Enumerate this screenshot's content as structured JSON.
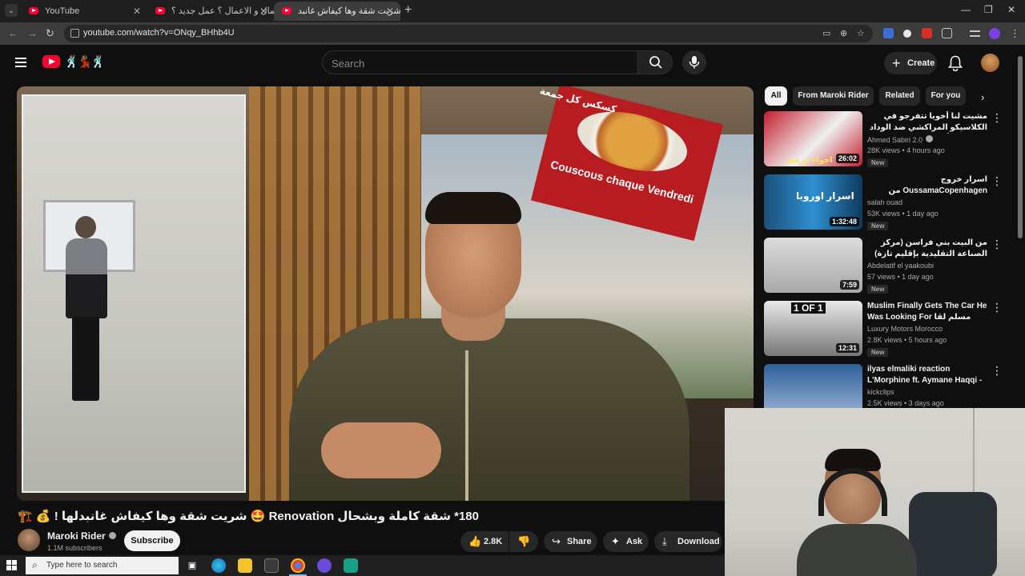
{
  "browser": {
    "tabs": [
      {
        "title": "YouTube",
        "active": false
      },
      {
        "title": "رحلة المال و الاعمال ؟ عمل جديد ؟",
        "active": false
      },
      {
        "title": "شريت شقة وها كيفاش غانبد..",
        "active": true
      }
    ],
    "url": "youtube.com/watch?v=ONqy_BHhb4U"
  },
  "header": {
    "search_placeholder": "Search",
    "create_label": "Create",
    "doodle": "🕺🏽💃🏽🕺🏽"
  },
  "video": {
    "sign_arabic": "كسكس كل جمعة",
    "sign_text": "Couscous chaque Vendredi",
    "title": "180* شقة كاملة وبشحال Renovation 🤩 شريت شقة وها كيفاش غانبدلها ! 💰 🏗️"
  },
  "channel": {
    "name": "Maroki Rider",
    "subscribers": "1.1M subscribers",
    "subscribe_label": "Subscribe"
  },
  "actions": {
    "likes": "2.8K",
    "share": "Share",
    "ask": "Ask",
    "download": "Download"
  },
  "chips": [
    "All",
    "From Maroki Rider",
    "Related",
    "For you"
  ],
  "recommendations": [
    {
      "title": "مشيت لنا أخويا تتفرجو في الكلاسيكو المراكشي ضد الوداد البيضاوي أجواء ... 😍",
      "channel": "Ahmed Sabiri 2.0",
      "verified": true,
      "stats": "28K views • 4 hours ago",
      "badge": "New",
      "duration": "26:02"
    },
    {
      "title": "اسرار خروج OussamaCopenhagen من الفقر...",
      "channel": "salah ouad",
      "verified": false,
      "stats": "53K views • 1 day ago",
      "badge": "New",
      "duration": "1:32:48"
    },
    {
      "title": "من البيت بني فراسن (مركز الصناعة التقليدية بإقليم تازة) المغرب وتكتشف سوقها...",
      "channel": "Abdelatif el yaakoubi",
      "verified": false,
      "stats": "57 views • 1 day ago",
      "badge": "New",
      "duration": "7:59"
    },
    {
      "title": "Muslim Finally Gets The Car He Was Looking For مسلم لقا الطوموبيل...",
      "channel": "Luxury Motors Morocco",
      "verified": false,
      "stats": "2.8K views • 5 hours ago",
      "badge": "New",
      "duration": "12:31"
    },
    {
      "title": "ilyas elmaliki reaction L'Morphine ft. Aymane Haqqi - ...",
      "channel": "kickclips",
      "verified": false,
      "stats": "2.5K views • 3 days ago",
      "badge": "",
      "duration": ""
    }
  ],
  "thumb_text": [
    "اجواء مرعبة",
    "اسرار اوروبا",
    "1 OF 1"
  ],
  "taskbar": {
    "search_placeholder": "Type here to search"
  },
  "colors": {
    "background": "#0f0f0f",
    "youtube_red": "#ff0033",
    "chip_active": "#f1f1f1",
    "pill": "#272727"
  }
}
